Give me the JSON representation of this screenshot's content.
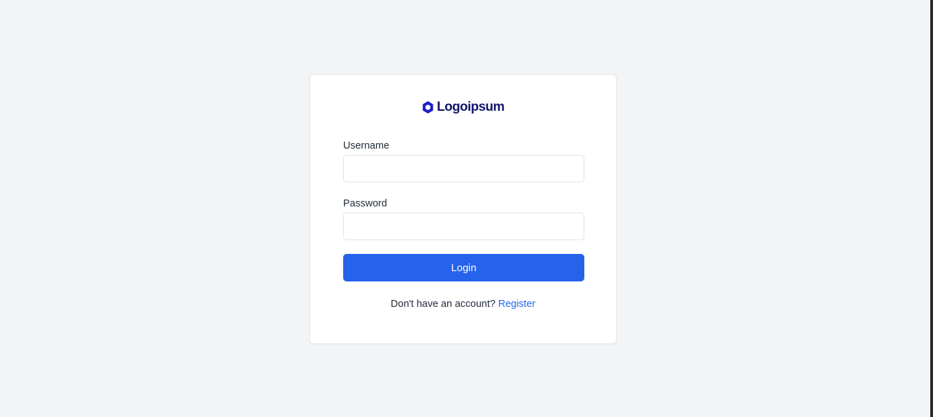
{
  "brand": {
    "name": "Logoipsum",
    "color": "#14146b"
  },
  "form": {
    "username_label": "Username",
    "username_value": "",
    "password_label": "Password",
    "password_value": "",
    "submit_label": "Login"
  },
  "footer": {
    "prompt": "Don't have an account?",
    "register_label": "Register"
  },
  "colors": {
    "background": "#f3f4f6",
    "accent": "#2563eb",
    "card": "#ffffff"
  },
  "icons": {
    "logo": "logoipsum-mark-icon"
  }
}
